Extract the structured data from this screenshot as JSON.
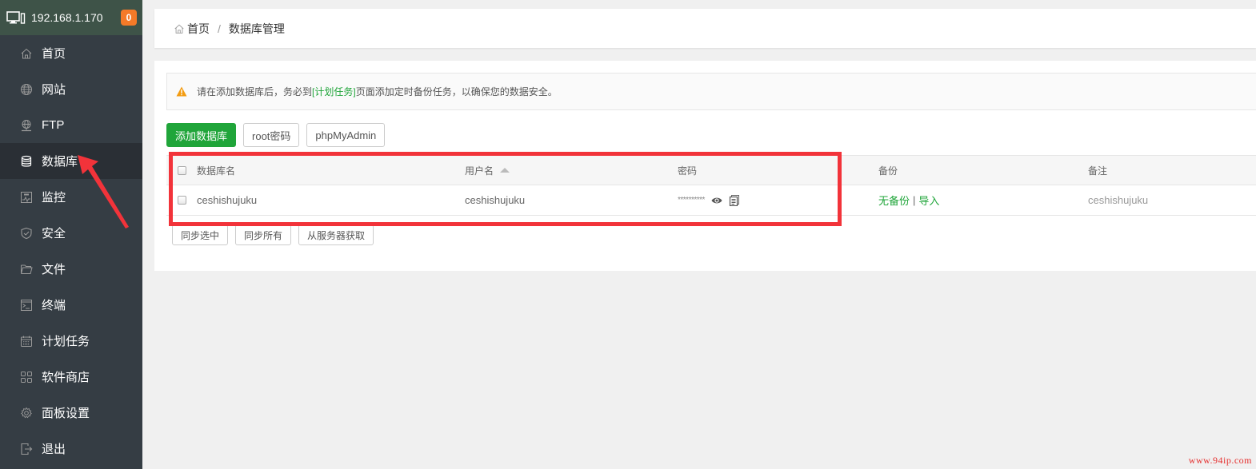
{
  "sidebar": {
    "server_ip": "192.168.1.170",
    "notification_count": "0",
    "items": [
      {
        "label": "首页",
        "icon": "home-icon",
        "active": false
      },
      {
        "label": "网站",
        "icon": "globe-icon",
        "active": false
      },
      {
        "label": "FTP",
        "icon": "ftp-icon",
        "active": false
      },
      {
        "label": "数据库",
        "icon": "database-icon",
        "active": true
      },
      {
        "label": "监控",
        "icon": "monitor-icon",
        "active": false
      },
      {
        "label": "安全",
        "icon": "shield-icon",
        "active": false
      },
      {
        "label": "文件",
        "icon": "folder-icon",
        "active": false
      },
      {
        "label": "终端",
        "icon": "terminal-icon",
        "active": false
      },
      {
        "label": "计划任务",
        "icon": "calendar-icon",
        "active": false
      },
      {
        "label": "软件商店",
        "icon": "apps-grid-icon",
        "active": false
      },
      {
        "label": "面板设置",
        "icon": "gear-icon",
        "active": false
      },
      {
        "label": "退出",
        "icon": "logout-icon",
        "active": false
      }
    ]
  },
  "breadcrumb": {
    "home": "首页",
    "separator": "/",
    "current": "数据库管理"
  },
  "notice": {
    "prefix": "请在添加数据库后，务必到",
    "link": "[计划任务]",
    "suffix": "页面添加定时备份任务，以确保您的数据安全。"
  },
  "toolbar": {
    "add_database": "添加数据库",
    "root_password": "root密码",
    "phpmyadmin": "phpMyAdmin"
  },
  "table": {
    "headers": {
      "name": "数据库名",
      "user": "用户名",
      "password": "密码",
      "backup": "备份",
      "note": "备注"
    },
    "rows": [
      {
        "name": "ceshishujuku",
        "user": "ceshishujuku",
        "password": "**********",
        "backup_status": "无备份",
        "backup_sep": "|",
        "import": "导入",
        "note": "ceshishujuku"
      }
    ]
  },
  "bottom_tools": {
    "sync_selected": "同步选中",
    "sync_all": "同步所有",
    "fetch_from_server": "从服务器获取"
  },
  "watermark": "www.94ip.com",
  "colors": {
    "accent_green": "#20a53a",
    "sidebar_bg": "#353d44",
    "sidebar_header_bg": "#3e5348",
    "badge_orange": "#f47a28",
    "annotation_red": "#f2333a"
  }
}
